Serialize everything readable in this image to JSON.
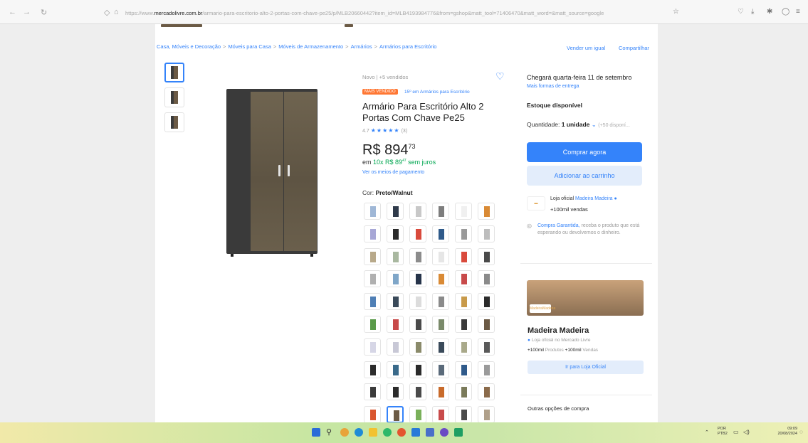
{
  "browser": {
    "back_icon": "arrow-left-icon",
    "forward_icon": "arrow-right-icon",
    "reload_icon": "reload-icon",
    "url_prefix": "https://www.",
    "url_host": "mercadolivre.com.br",
    "url_path": "/armario-para-escritorio-alto-2-portas-com-chave-pe25/p/MLB20660442?item_id=MLB4193984776&from=gshop&matt_tool=71406470&matt_word=&matt_source=google"
  },
  "breadcrumb": {
    "items": [
      "Casa, Móveis e Decoração",
      "Móveis para Casa",
      "Móveis de Armazenamento",
      "Armários",
      "Armários para Escritório"
    ],
    "separator": ">",
    "sell_link": "Vender um igual",
    "share_link": "Compartilhar"
  },
  "product": {
    "meta": "Novo | +5 vendidos",
    "badge": "MAIS VENDIDO",
    "rank": "15º em Armários para Escritório",
    "title": "Armário Para Escritório Alto 2 Portas Com Chave Pe25",
    "rating": "4.7",
    "stars": "★★★★★",
    "reviews": "(3)",
    "currency": "R$",
    "price_int": "894",
    "price_cents": "73",
    "installment_prefix": "em",
    "installment_main": "10x R$ 89",
    "installment_cents": "47",
    "installment_suffix": "sem juros",
    "payment_link": "Ver os meios de pagamento",
    "color_label": "Cor:",
    "color_value": "Preto/Walnut"
  },
  "buybox": {
    "shipping": "Chegará quarta-feira 11 de setembro",
    "shipping_link": "Mais formas de entrega",
    "stock": "Estoque disponível",
    "qty_label": "Quantidade:",
    "qty_value": "1 unidade",
    "qty_avail": "(+50 disponí...",
    "buy_button": "Comprar agora",
    "cart_button": "Adicionar ao carrinho",
    "seller_prefix": "Loja oficial",
    "seller_name": "Madeira Madeira",
    "seller_sales": "+100mil vendas",
    "guarantee_link": "Compra Garantida,",
    "guarantee_text": "receba o produto que está esperando ou devolvemos o dinheiro."
  },
  "store": {
    "name": "Madeira Madeira",
    "official": "Loja oficial no Mercado Livre",
    "products_count": "+100mil",
    "products_label": "Produtos",
    "sales_count": "+100mil",
    "sales_label": "Vendas",
    "button": "Ir para Loja Oficial",
    "logo_text": "MadeiraMadeira"
  },
  "other_options": "Outras opções de compra",
  "taskbar": {
    "lang_top": "POR",
    "lang_bottom": "PTB2",
    "time": "09:09",
    "date": "20/08/2024"
  }
}
